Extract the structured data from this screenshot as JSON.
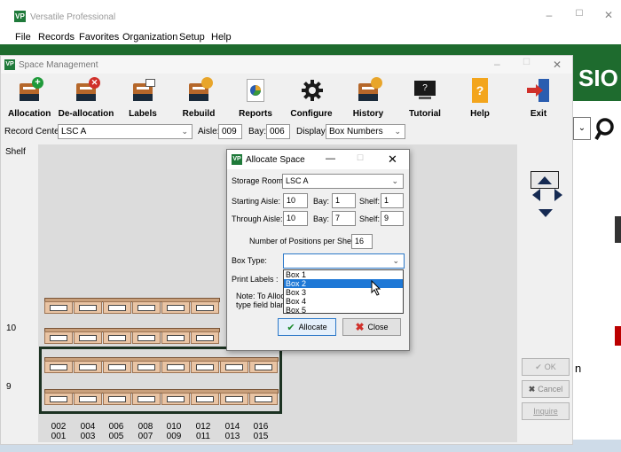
{
  "app": {
    "title": "Versatile Professional",
    "menu": [
      "File",
      "Records",
      "Favorites",
      "Organization",
      "Setup",
      "Help"
    ],
    "banner_fragment": "SIO",
    "right_fragment": "n"
  },
  "window": {
    "title": "Space Management",
    "toolbar": [
      {
        "label": "Allocation",
        "icon": "box-add-icon"
      },
      {
        "label": "De-allocation",
        "icon": "box-remove-icon"
      },
      {
        "label": "Labels",
        "icon": "box-label-icon"
      },
      {
        "label": "Rebuild",
        "icon": "box-rebuild-icon"
      },
      {
        "label": "Reports",
        "icon": "reports-icon"
      },
      {
        "label": "Configure",
        "icon": "gear-icon"
      },
      {
        "label": "History",
        "icon": "box-history-icon"
      },
      {
        "label": "Tutorial",
        "icon": "tutorial-icon"
      },
      {
        "label": "Help",
        "icon": "help-icon"
      },
      {
        "label": "Exit",
        "icon": "exit-icon"
      }
    ],
    "filters": {
      "record_center_label": "Record Center:",
      "record_center_value": "LSC A",
      "aisle_label": "Aisle:",
      "aisle_value": "009",
      "bay_label": "Bay:",
      "bay_value": "006",
      "display_label": "Display:",
      "display_value": "Box Numbers"
    },
    "shelf_label": "Shelf",
    "row_labels": {
      "top": "10",
      "bottom": "9"
    },
    "axis_top": [
      "002",
      "004",
      "006",
      "008",
      "010",
      "012",
      "014",
      "016"
    ],
    "axis_bottom": [
      "001",
      "003",
      "005",
      "007",
      "009",
      "011",
      "013",
      "015"
    ],
    "side_buttons": {
      "ok": "OK",
      "cancel": "Cancel",
      "inquire": "Inquire"
    }
  },
  "dialog": {
    "title": "Allocate Space",
    "storage_room_label": "Storage Room:",
    "storage_room_value": "LSC A",
    "starting_aisle_label": "Starting Aisle:",
    "starting_aisle": "10",
    "starting_bay_label": "Bay:",
    "starting_bay": "1",
    "starting_shelf_label": "Shelf:",
    "starting_shelf": "1",
    "through_aisle_label": "Through Aisle:",
    "through_aisle": "10",
    "through_bay_label": "Bay:",
    "through_bay": "7",
    "through_shelf_label": "Shelf:",
    "through_shelf": "9",
    "positions_label": "Number of Positions per Shelf:",
    "positions_value": "16",
    "box_type_label": "Box Type:",
    "box_type_value": "",
    "box_type_options": [
      "Box 1",
      "Box 2",
      "Box 3",
      "Box 4",
      "Box 5"
    ],
    "box_type_highlighted": "Box 2",
    "print_labels_label": "Print Labels :",
    "note_line1": "Note: To Alloca",
    "note_line2": "type field blan",
    "allocate_label": "Allocate",
    "close_label": "Close"
  },
  "colors": {
    "brand_green": "#1e6b2e",
    "selection_blue": "#1e78d6",
    "box_tan": "#e9c4a4"
  }
}
